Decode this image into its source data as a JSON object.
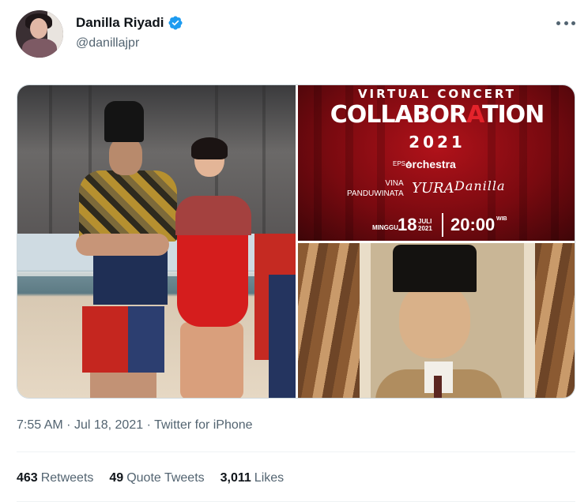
{
  "author": {
    "display_name": "Danilla Riyadi",
    "handle": "@danillajpr",
    "verified": true,
    "avatar_icon": "avatar"
  },
  "menu": {
    "icon": "more-icon"
  },
  "media": {
    "poster": {
      "line1": "VIRTUAL CONCERT",
      "title_a": "COLLABOR",
      "title_b": "A",
      "title_c": "TION",
      "year": "2021",
      "eps": "EPS 1",
      "orchestra": "orchestra",
      "name_top": "VINA",
      "name_bottom": "PANDUWINATA",
      "yura": "YURA",
      "danilla": "Danilla",
      "day_name": "MINGGU",
      "day": "18",
      "month": "JULI",
      "month_year": "2021",
      "time": "20:00",
      "tz": "WIB"
    },
    "accent_color": "#e4232b",
    "background_color": "#7a0a10"
  },
  "meta": {
    "time": "7:55 AM",
    "date": "Jul 18, 2021",
    "source": "Twitter for iPhone",
    "sep": "·"
  },
  "stats": {
    "retweets_count": "463",
    "retweets_label": "Retweets",
    "quotes_count": "49",
    "quotes_label": "Quote Tweets",
    "likes_count": "3,011",
    "likes_label": "Likes"
  },
  "colors": {
    "verified": "#1d9bf0",
    "secondary_text": "#536471"
  }
}
